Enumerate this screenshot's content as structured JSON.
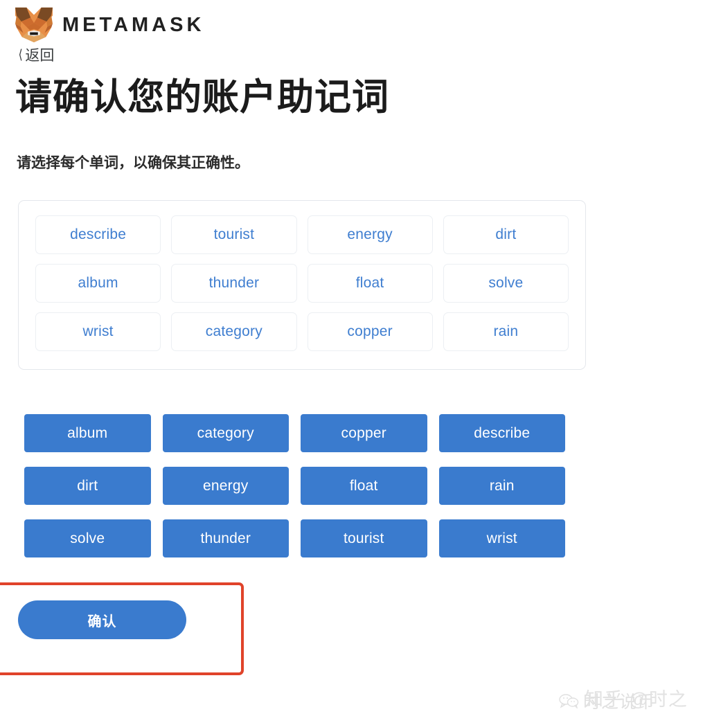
{
  "header": {
    "brand": "METAMASK",
    "logo_icon": "metamask-fox-icon",
    "back_label": "返回",
    "back_icon": "chevron-left-icon"
  },
  "page": {
    "title": "请确认您的账户助记词",
    "subtitle": "请选择每个单词，以确保其正确性。"
  },
  "selected_panel": {
    "words": [
      "describe",
      "tourist",
      "energy",
      "dirt",
      "album",
      "thunder",
      "float",
      "solve",
      "wrist",
      "category",
      "copper",
      "rain"
    ]
  },
  "word_bank": {
    "words": [
      "album",
      "category",
      "copper",
      "describe",
      "dirt",
      "energy",
      "float",
      "rain",
      "solve",
      "thunder",
      "tourist",
      "wrist"
    ]
  },
  "actions": {
    "confirm_label": "确认"
  },
  "watermark": {
    "wechat_text": "时之说币",
    "zhihu_text": "知乎 @时之",
    "icon": "wechat-bubbles-icon"
  },
  "colors": {
    "primary_blue": "#3a7bce",
    "chip_text_blue": "#3f7ed0",
    "annotation_red": "#e0432a",
    "panel_border": "#e4e7ec"
  }
}
